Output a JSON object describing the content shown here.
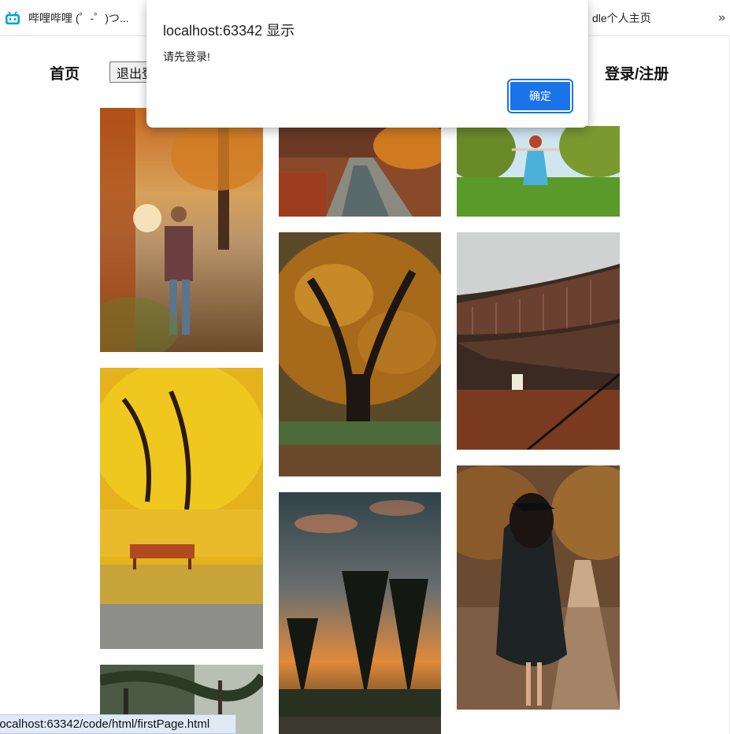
{
  "browser": {
    "bookmarks": [
      {
        "label": "哔哩哔哩 (゜-゜)つ...",
        "icon": "bilibili-icon"
      },
      {
        "label": "dle个人主页"
      }
    ],
    "overflow_label": "»",
    "status_url": "localhost:63342/code/html/firstPage.html"
  },
  "nav": {
    "home_label": "首页",
    "logout_label": "退出登录",
    "login_label": "登录/注册"
  },
  "dialog": {
    "title": "localhost:63342 显示",
    "message": "请先登录!",
    "ok_label": "确定"
  },
  "gallery": {
    "photos": [
      {
        "name": "photo-man-autumn-park",
        "subject": "man in plaid shirt in autumn park"
      },
      {
        "name": "photo-autumn-river",
        "subject": "autumn river reflection"
      },
      {
        "name": "photo-girl-blue-dress",
        "subject": "girl in blue dress on grass"
      },
      {
        "name": "photo-yellow-ginkgo-bench",
        "subject": "yellow ginkgo tree with bench"
      },
      {
        "name": "photo-autumn-oak-tree",
        "subject": "large autumn oak tree"
      },
      {
        "name": "photo-round-library",
        "subject": "circular library with bookshelves"
      },
      {
        "name": "photo-forest-canopy",
        "subject": "forest canopy"
      },
      {
        "name": "photo-pine-sunset",
        "subject": "pine trees at sunset"
      },
      {
        "name": "photo-graduate-walking",
        "subject": "graduate in gown walking on path"
      }
    ]
  },
  "colors": {
    "accent": "#1a73e8",
    "status_bar_bg": "#dfeaf6"
  }
}
